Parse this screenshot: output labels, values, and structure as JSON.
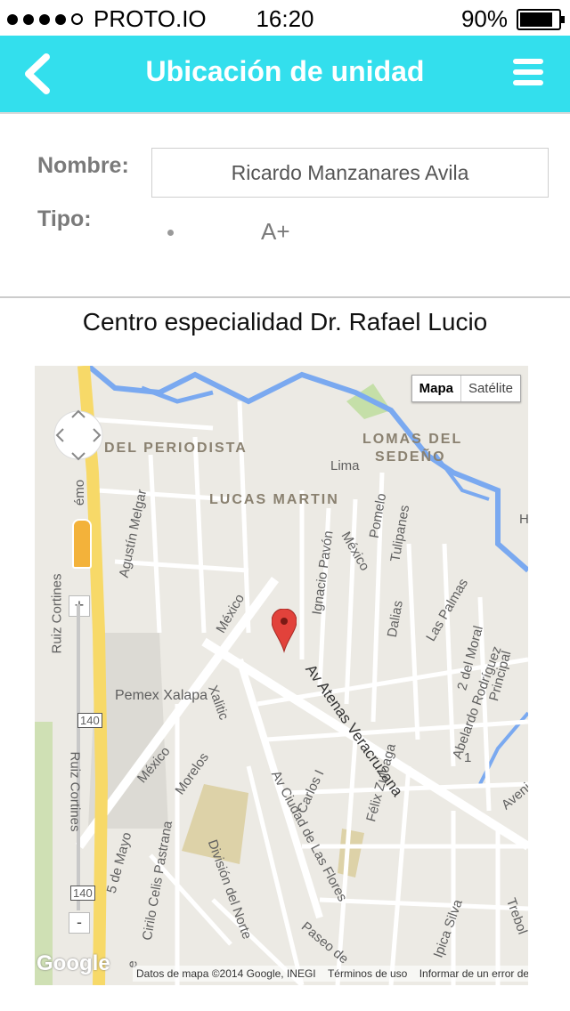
{
  "status": {
    "carrier": "PROTO.IO",
    "time": "16:20",
    "battery": "90%",
    "battery_level": 0.9
  },
  "nav": {
    "title": "Ubicación de unidad",
    "back_icon": "chevron-left-icon",
    "menu_icon": "hamburger-icon"
  },
  "form": {
    "name_label": "Nombre:",
    "name_value": "Ricardo Manzanares Avila",
    "type_label": "Tipo:",
    "type_value": "A+"
  },
  "location": {
    "hospital": "Centro especialidad Dr. Rafael Lucio"
  },
  "map": {
    "toggle": {
      "map": "Mapa",
      "satellite": "Satélite"
    },
    "zoom_in": "+",
    "zoom_out": "-",
    "areas": {
      "periodista": "DEL PERIODISTA",
      "lucas": "LUCAS MARTIN",
      "lomas1": "LOMAS DEL",
      "lomas2": "SEDEÑO"
    },
    "labels": {
      "lima": "Lima",
      "pomelo": "Pomelo",
      "tulipanes": "Tulipanes",
      "mexico1": "México",
      "mexico2": "México",
      "mexico3": "México",
      "ignacio": "Ignacio Pavón",
      "melgar": "Agustín Melgar",
      "ruiz1": "Ruiz Cortines",
      "ruiz2": "Ruiz Cortines",
      "pemex": "Pemex Xalapa",
      "xalitic": "Xalitic",
      "atenas": "Av Atenas Veracruzana",
      "morelos": "Morelos",
      "carlos": "Carlos I",
      "flores": "Av Ciudad de Las Flores",
      "felix": "Félix Zuloaga",
      "dalias": "Dalias",
      "palmas": "Las Palmas",
      "moral": "2 del Moral",
      "abelardo": "Abelardo Rodríguez",
      "principal": "Principal",
      "mayo": "5 de Mayo",
      "cirilo": "Cirilo Celis Pastrana",
      "division": "División del Norte",
      "paseo": "Paseo de",
      "silva": "Ipica Silva",
      "trebol": "Trebol",
      "avenida": "Avenida",
      "shield140": "140",
      "shield140b": "140",
      "mo": "émo",
      "h": "H",
      "e": "e",
      "uno": "1"
    },
    "google": "Google",
    "footer": {
      "data": "Datos de mapa ©2014 Google, INEGI",
      "terms": "Términos de uso",
      "report": "Informar de un error de Maps"
    }
  }
}
